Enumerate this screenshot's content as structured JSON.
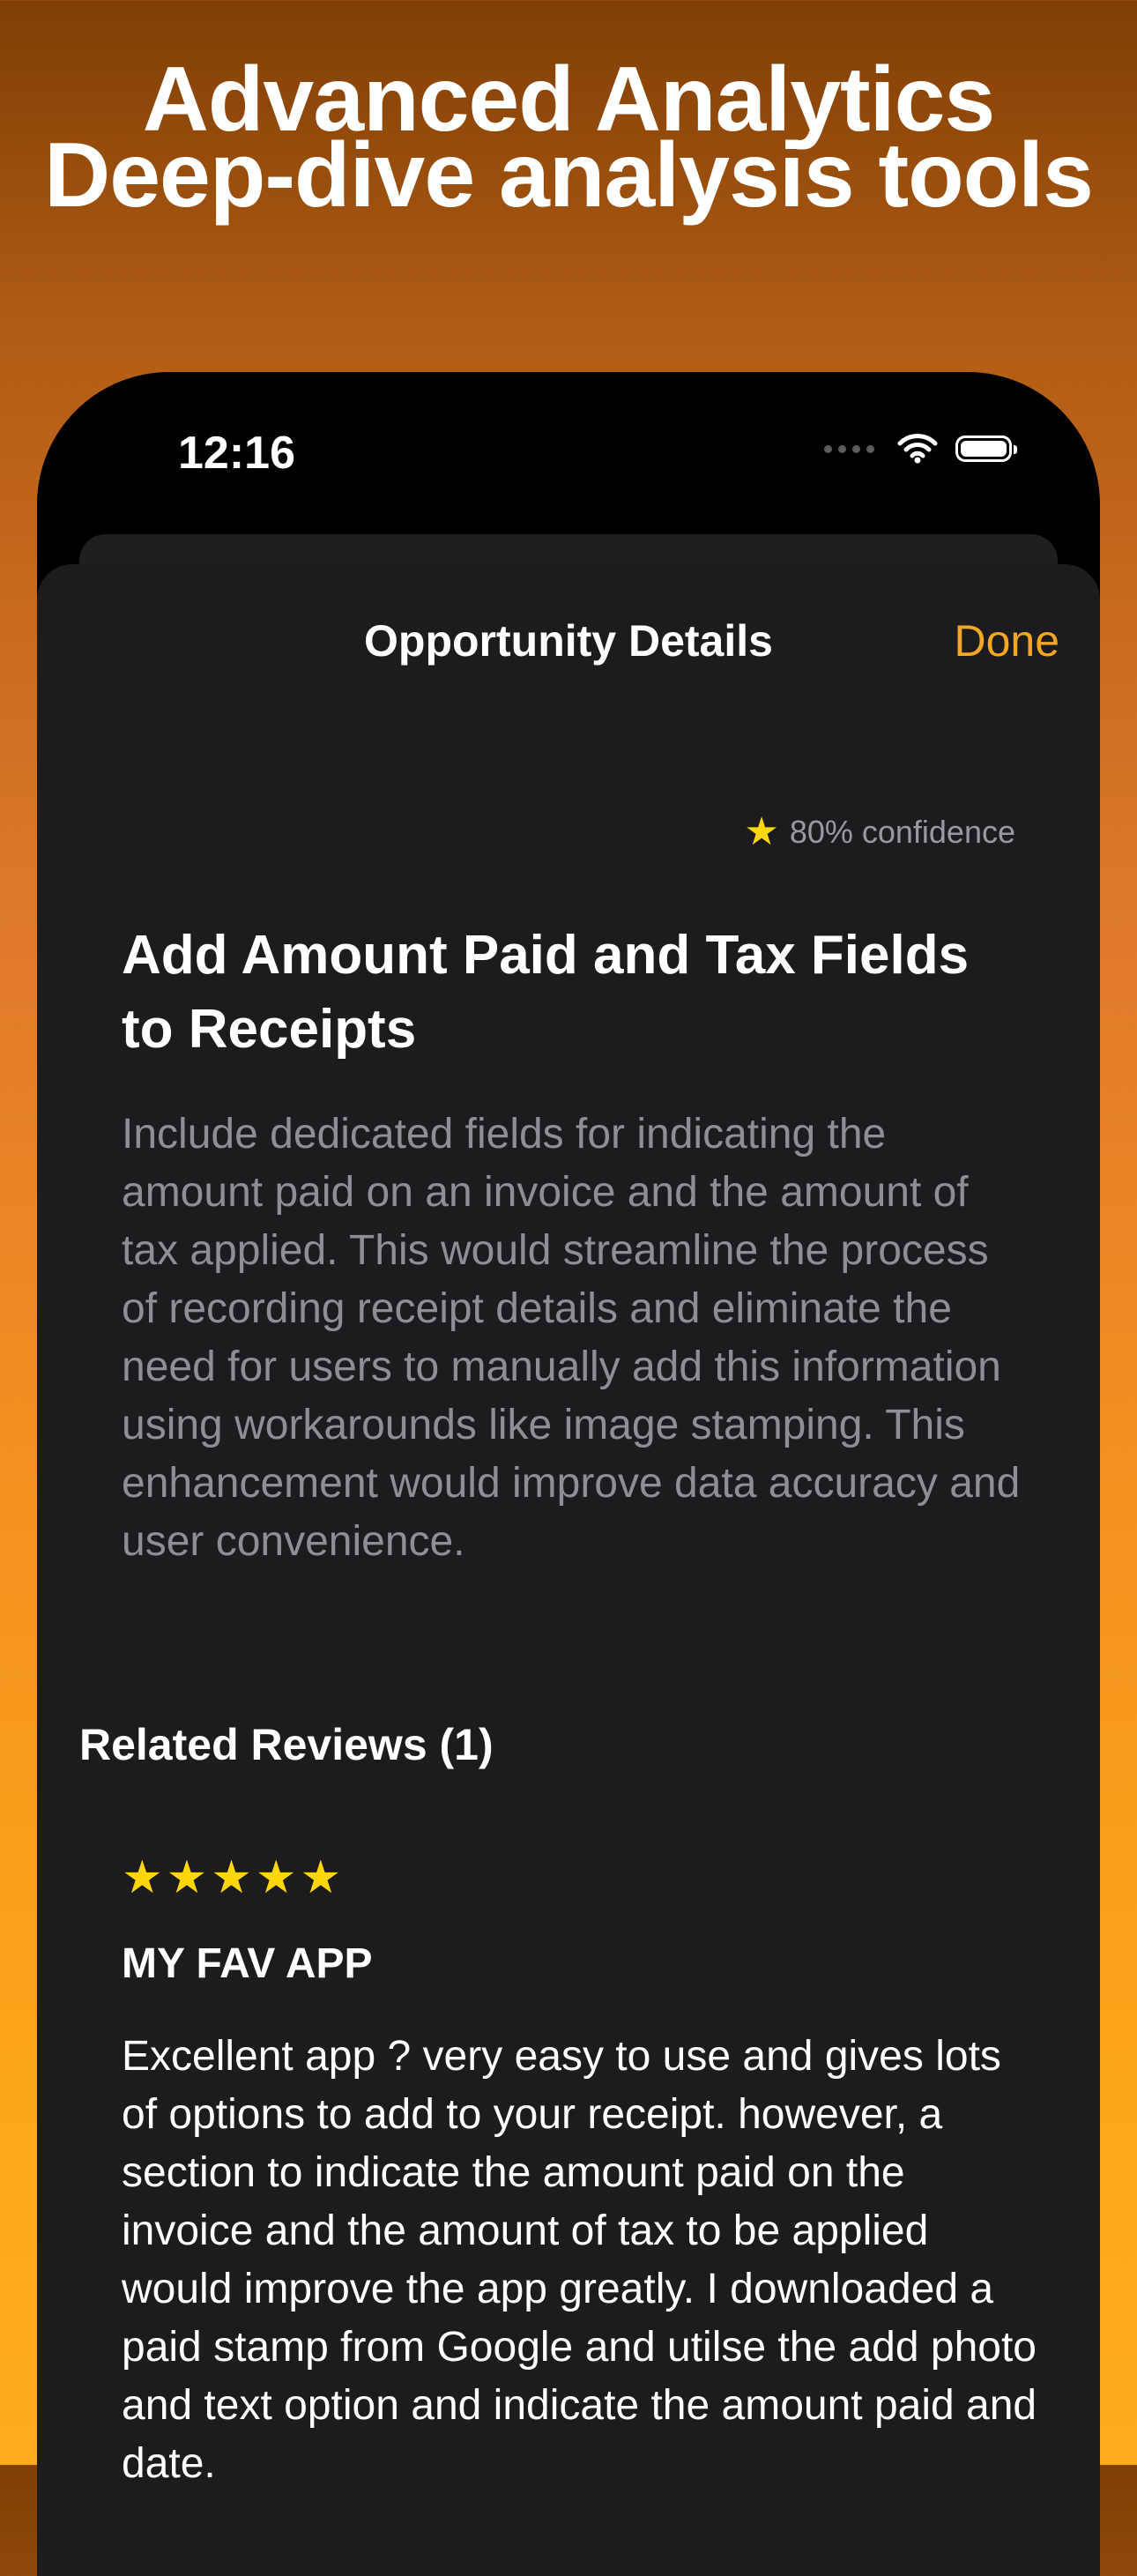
{
  "headline": {
    "line1": "Advanced Analytics",
    "line2": "Deep-dive analysis tools"
  },
  "status_bar": {
    "time": "12:16",
    "icons": [
      "signal-icon",
      "wifi-icon",
      "battery-icon"
    ]
  },
  "nav": {
    "title": "Opportunity Details",
    "done_label": "Done"
  },
  "opportunity": {
    "confidence": "80% confidence",
    "title": "Add Amount Paid and Tax Fields to Receipts",
    "description": "Include dedicated fields for indicating the amount paid on an invoice and the amount of tax applied. This would streamline the process of recording receipt details and eliminate the need for users to manually add this information using workarounds like image stamping. This enhancement would improve data accuracy and user convenience."
  },
  "related_reviews": {
    "header": "Related Reviews (1)",
    "items": [
      {
        "rating": 5,
        "title": "MY FAV APP",
        "body": "Excellent app ? very easy to use and gives lots of options to add to your receipt. however, a section to indicate the amount paid on the invoice and the amount of tax to be applied would improve the app greatly. I downloaded a paid stamp from Google and utilse the add photo and text option and indicate the amount paid and date."
      }
    ]
  },
  "colors": {
    "accent": "#f5a623",
    "star": "#ffd60a",
    "sheet_background": "#1c1c1e",
    "secondary_text": "#8e8e93"
  }
}
